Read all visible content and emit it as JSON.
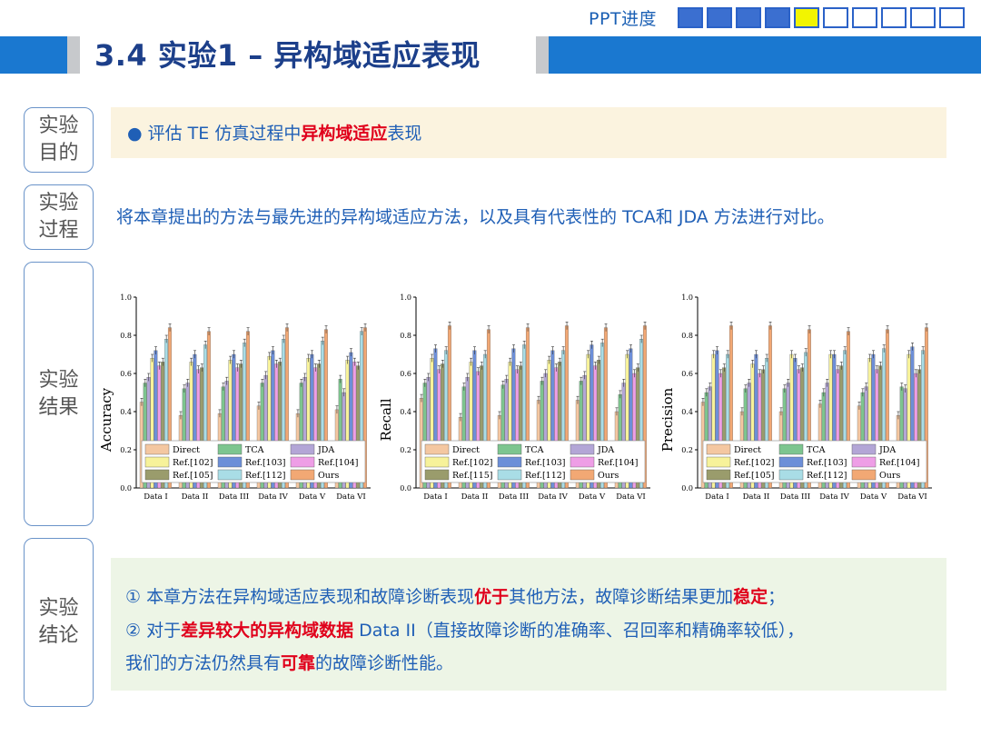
{
  "header": {
    "progress_label": "PPT进度",
    "progress": {
      "total": 10,
      "completed": 4,
      "current": 5
    },
    "colors": {
      "done": "#3b6fd0",
      "current": "#f2f500",
      "bar": "#1a78d0"
    }
  },
  "title": "3.4 实验1 – 异构域适应表现",
  "sections": {
    "purpose": {
      "label": "实验目的",
      "label_l1": "实验",
      "label_l2": "目的"
    },
    "process": {
      "label_l1": "实验",
      "label_l2": "过程"
    },
    "results": {
      "label_l1": "实验",
      "label_l2": "结果"
    },
    "conclusion": {
      "label_l1": "实验",
      "label_l2": "结论"
    }
  },
  "purpose": {
    "bullet": "●",
    "pre": "评估 TE 仿真过程中",
    "highlight": "异构域适应",
    "post": "表现"
  },
  "process_text": "将本章提出的方法与最先进的异构域适应方法，以及具有代表性的 TCA和 JDA 方法进行对比。",
  "conclusion": {
    "line1_pre": "① 本章方法在异构域适应表现和故障诊断表现",
    "line1_hl1": "优于",
    "line1_mid": "其他方法，故障诊断结果更加",
    "line1_hl2": "稳定",
    "line1_post": "；",
    "line2_pre": "② 对于",
    "line2_hl": "差异较大的异构域数据",
    "line2_post": " Data II（直接故障诊断的准确率、召回率和精确率较低），",
    "line3_pre": "我们的方法仍然具有",
    "line3_hl": "可靠",
    "line3_post": "的故障诊断性能。"
  },
  "chart_data": [
    {
      "type": "bar",
      "ylabel": "Accuracy",
      "ylim": [
        0,
        1.0
      ],
      "yticks": [
        "0.0",
        "0.2",
        "0.4",
        "0.6",
        "0.8",
        "1.0"
      ],
      "categories": [
        "Data I",
        "Data II",
        "Data III",
        "Data IV",
        "Data V",
        "Data VI"
      ],
      "legend": "bottom-left",
      "series": [
        {
          "name": "Direct",
          "color": "#f4c7a1",
          "values": [
            0.45,
            0.38,
            0.39,
            0.43,
            0.39,
            0.41
          ]
        },
        {
          "name": "TCA",
          "color": "#7dc58f",
          "values": [
            0.55,
            0.52,
            0.53,
            0.55,
            0.55,
            0.57
          ]
        },
        {
          "name": "JDA",
          "color": "#b3a6d6",
          "values": [
            0.58,
            0.55,
            0.56,
            0.59,
            0.58,
            0.5
          ]
        },
        {
          "name": "Ref.[102]",
          "color": "#f7f29a",
          "values": [
            0.68,
            0.66,
            0.67,
            0.69,
            0.68,
            0.67
          ]
        },
        {
          "name": "Ref.[103]",
          "color": "#6d8fd8",
          "values": [
            0.72,
            0.7,
            0.7,
            0.72,
            0.7,
            0.71
          ]
        },
        {
          "name": "Ref.[104]",
          "color": "#ee9ee6",
          "values": [
            0.64,
            0.62,
            0.63,
            0.65,
            0.63,
            0.66
          ]
        },
        {
          "name": "Ref.[105]",
          "color": "#9a9c6c",
          "values": [
            0.66,
            0.63,
            0.65,
            0.66,
            0.65,
            0.64
          ]
        },
        {
          "name": "Ref.[112]",
          "color": "#a9dde6",
          "values": [
            0.78,
            0.75,
            0.76,
            0.78,
            0.77,
            0.82
          ]
        },
        {
          "name": "Ours",
          "color": "#f2a874",
          "values": [
            0.84,
            0.82,
            0.82,
            0.84,
            0.83,
            0.84
          ]
        }
      ]
    },
    {
      "type": "bar",
      "ylabel": "Recall",
      "ylim": [
        0,
        1.0
      ],
      "yticks": [
        "0.0",
        "0.2",
        "0.4",
        "0.6",
        "0.8",
        "1.0"
      ],
      "categories": [
        "Data I",
        "Data II",
        "Data III",
        "Data IV",
        "Data V",
        "Data VI"
      ],
      "legend": "bottom-left",
      "series": [
        {
          "name": "Direct",
          "color": "#f4c7a1",
          "values": [
            0.47,
            0.37,
            0.38,
            0.46,
            0.46,
            0.4
          ]
        },
        {
          "name": "TCA",
          "color": "#7dc58f",
          "values": [
            0.55,
            0.53,
            0.54,
            0.56,
            0.56,
            0.49
          ]
        },
        {
          "name": "JDA",
          "color": "#b3a6d6",
          "values": [
            0.58,
            0.58,
            0.57,
            0.6,
            0.59,
            0.55
          ]
        },
        {
          "name": "Ref.[102]",
          "color": "#f7f29a",
          "values": [
            0.68,
            0.66,
            0.66,
            0.67,
            0.7,
            0.7
          ]
        },
        {
          "name": "Ref.[103]",
          "color": "#6d8fd8",
          "values": [
            0.73,
            0.72,
            0.73,
            0.72,
            0.75,
            0.73
          ]
        },
        {
          "name": "Ref.[104]",
          "color": "#ee9ee6",
          "values": [
            0.62,
            0.61,
            0.62,
            0.63,
            0.64,
            0.6
          ]
        },
        {
          "name": "Ref.[115]",
          "color": "#9a9c6c",
          "values": [
            0.65,
            0.64,
            0.64,
            0.66,
            0.67,
            0.63
          ]
        },
        {
          "name": "Ref.[112]",
          "color": "#a9dde6",
          "values": [
            0.72,
            0.7,
            0.75,
            0.72,
            0.76,
            0.78
          ]
        },
        {
          "name": "Ours",
          "color": "#f2a874",
          "values": [
            0.85,
            0.83,
            0.84,
            0.85,
            0.84,
            0.85
          ]
        }
      ]
    },
    {
      "type": "bar",
      "ylabel": "Precision",
      "ylim": [
        0,
        1.0
      ],
      "yticks": [
        "0.0",
        "0.2",
        "0.4",
        "0.6",
        "0.8",
        "1.0"
      ],
      "categories": [
        "Data I",
        "Data II",
        "Data III",
        "Data IV",
        "Data V",
        "Data VI"
      ],
      "legend": "bottom-left",
      "series": [
        {
          "name": "Direct",
          "color": "#f4c7a1",
          "values": [
            0.45,
            0.4,
            0.4,
            0.44,
            0.43,
            0.38
          ]
        },
        {
          "name": "TCA",
          "color": "#7dc58f",
          "values": [
            0.5,
            0.52,
            0.52,
            0.5,
            0.5,
            0.53
          ]
        },
        {
          "name": "JDA",
          "color": "#b3a6d6",
          "values": [
            0.53,
            0.55,
            0.55,
            0.55,
            0.53,
            0.52
          ]
        },
        {
          "name": "Ref.[102]",
          "color": "#f7f29a",
          "values": [
            0.7,
            0.65,
            0.7,
            0.7,
            0.68,
            0.7
          ]
        },
        {
          "name": "Ref.[103]",
          "color": "#6d8fd8",
          "values": [
            0.72,
            0.7,
            0.68,
            0.7,
            0.7,
            0.74
          ]
        },
        {
          "name": "Ref.[104]",
          "color": "#ee9ee6",
          "values": [
            0.6,
            0.6,
            0.62,
            0.62,
            0.62,
            0.6
          ]
        },
        {
          "name": "Ref.[105]",
          "color": "#9a9c6c",
          "values": [
            0.63,
            0.62,
            0.63,
            0.64,
            0.64,
            0.62
          ]
        },
        {
          "name": "Ref.[112]",
          "color": "#a9dde6",
          "values": [
            0.7,
            0.68,
            0.71,
            0.72,
            0.73,
            0.72
          ]
        },
        {
          "name": "Ours",
          "color": "#f2a874",
          "values": [
            0.85,
            0.85,
            0.83,
            0.82,
            0.83,
            0.84
          ]
        }
      ]
    }
  ]
}
